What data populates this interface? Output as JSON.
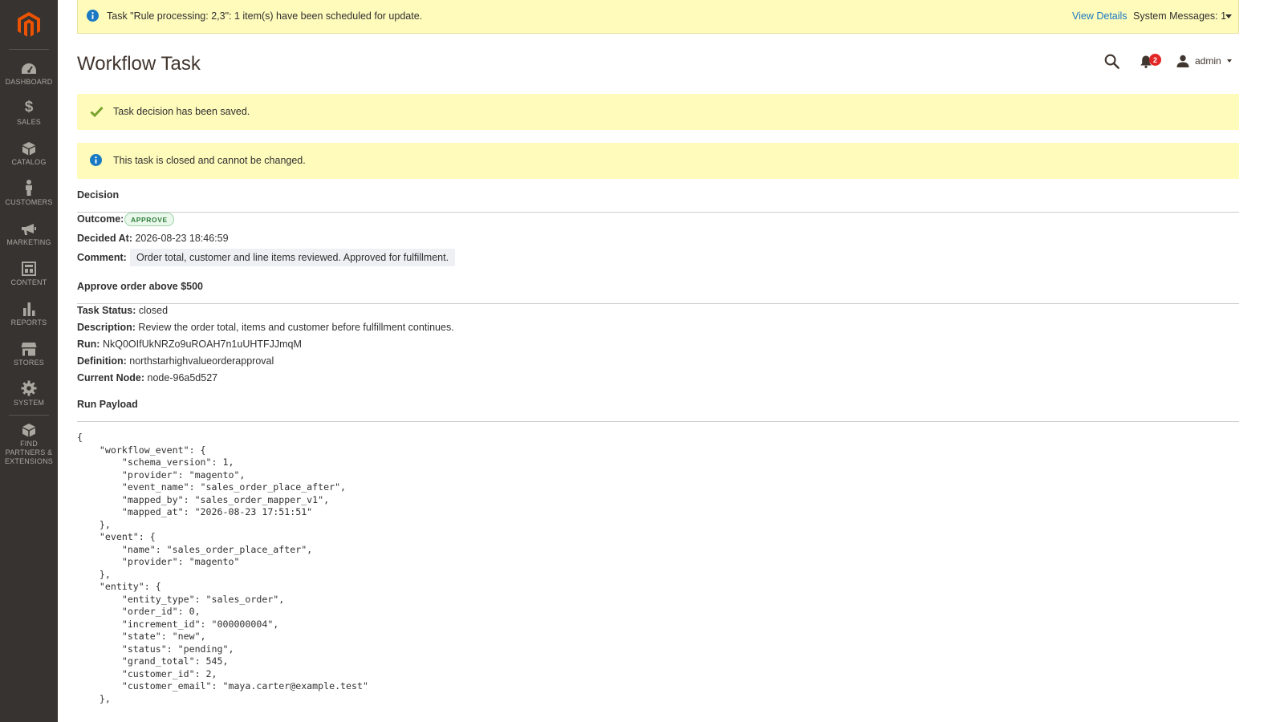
{
  "sidebar": {
    "items": [
      {
        "label": "DASHBOARD",
        "icon": "dashboard-icon"
      },
      {
        "label": "SALES",
        "icon": "dollar-icon"
      },
      {
        "label": "CATALOG",
        "icon": "box-icon"
      },
      {
        "label": "CUSTOMERS",
        "icon": "person-icon"
      },
      {
        "label": "MARKETING",
        "icon": "megaphone-icon"
      },
      {
        "label": "CONTENT",
        "icon": "layout-icon"
      },
      {
        "label": "REPORTS",
        "icon": "bar-chart-icon"
      },
      {
        "label": "STORES",
        "icon": "storefront-icon"
      },
      {
        "label": "SYSTEM",
        "icon": "gear-icon"
      },
      {
        "label": "FIND PARTNERS & EXTENSIONS",
        "icon": "extensions-box-icon"
      }
    ]
  },
  "system_bar": {
    "message": "Task \"Rule processing: 2,3\": 1 item(s) have been scheduled for update.",
    "view_details": "View Details",
    "system_messages": "System Messages: 1"
  },
  "header": {
    "title": "Workflow Task",
    "notification_count": "2",
    "user_name": "admin"
  },
  "messages": {
    "success": "Task decision has been saved.",
    "info": "This task is closed and cannot be changed."
  },
  "decision": {
    "title": "Decision",
    "outcome_label": "Outcome:",
    "outcome_value": "APPROVE",
    "decided_at_label": "Decided At:",
    "decided_at_value": "2026-08-23 18:46:59",
    "comment_label": "Comment:",
    "comment_value": "Order total, customer and line items reviewed. Approved for fulfillment."
  },
  "task": {
    "title": "Approve order above $500",
    "status_label": "Task Status:",
    "status_value": "closed",
    "description_label": "Description:",
    "description_value": "Review the order total, items and customer before fulfillment continues.",
    "run_label": "Run:",
    "run_value": "NkQ0OIfUkNRZo9uROAH7n1uUHTFJJmqM",
    "definition_label": "Definition:",
    "definition_value": "northstarhighvalueorderapproval",
    "node_label": "Current Node:",
    "node_value": "node-96a5d527"
  },
  "payload": {
    "title": "Run Payload",
    "text": "{\n    \"workflow_event\": {\n        \"schema_version\": 1,\n        \"provider\": \"magento\",\n        \"event_name\": \"sales_order_place_after\",\n        \"mapped_by\": \"sales_order_mapper_v1\",\n        \"mapped_at\": \"2026-08-23 17:51:51\"\n    },\n    \"event\": {\n        \"name\": \"sales_order_place_after\",\n        \"provider\": \"magento\"\n    },\n    \"entity\": {\n        \"entity_type\": \"sales_order\",\n        \"order_id\": 0,\n        \"increment_id\": \"000000004\",\n        \"state\": \"new\",\n        \"status\": \"pending\",\n        \"grand_total\": 545,\n        \"customer_id\": 2,\n        \"customer_email\": \"maya.carter@example.test\"\n    },"
  },
  "colors": {
    "sidebar_bg": "#373330",
    "notice_bg": "#fffbbb",
    "brand_orange": "#eb5202",
    "link_blue": "#1979c3",
    "success_green": "#79a22e",
    "badge_red": "#e22626"
  }
}
